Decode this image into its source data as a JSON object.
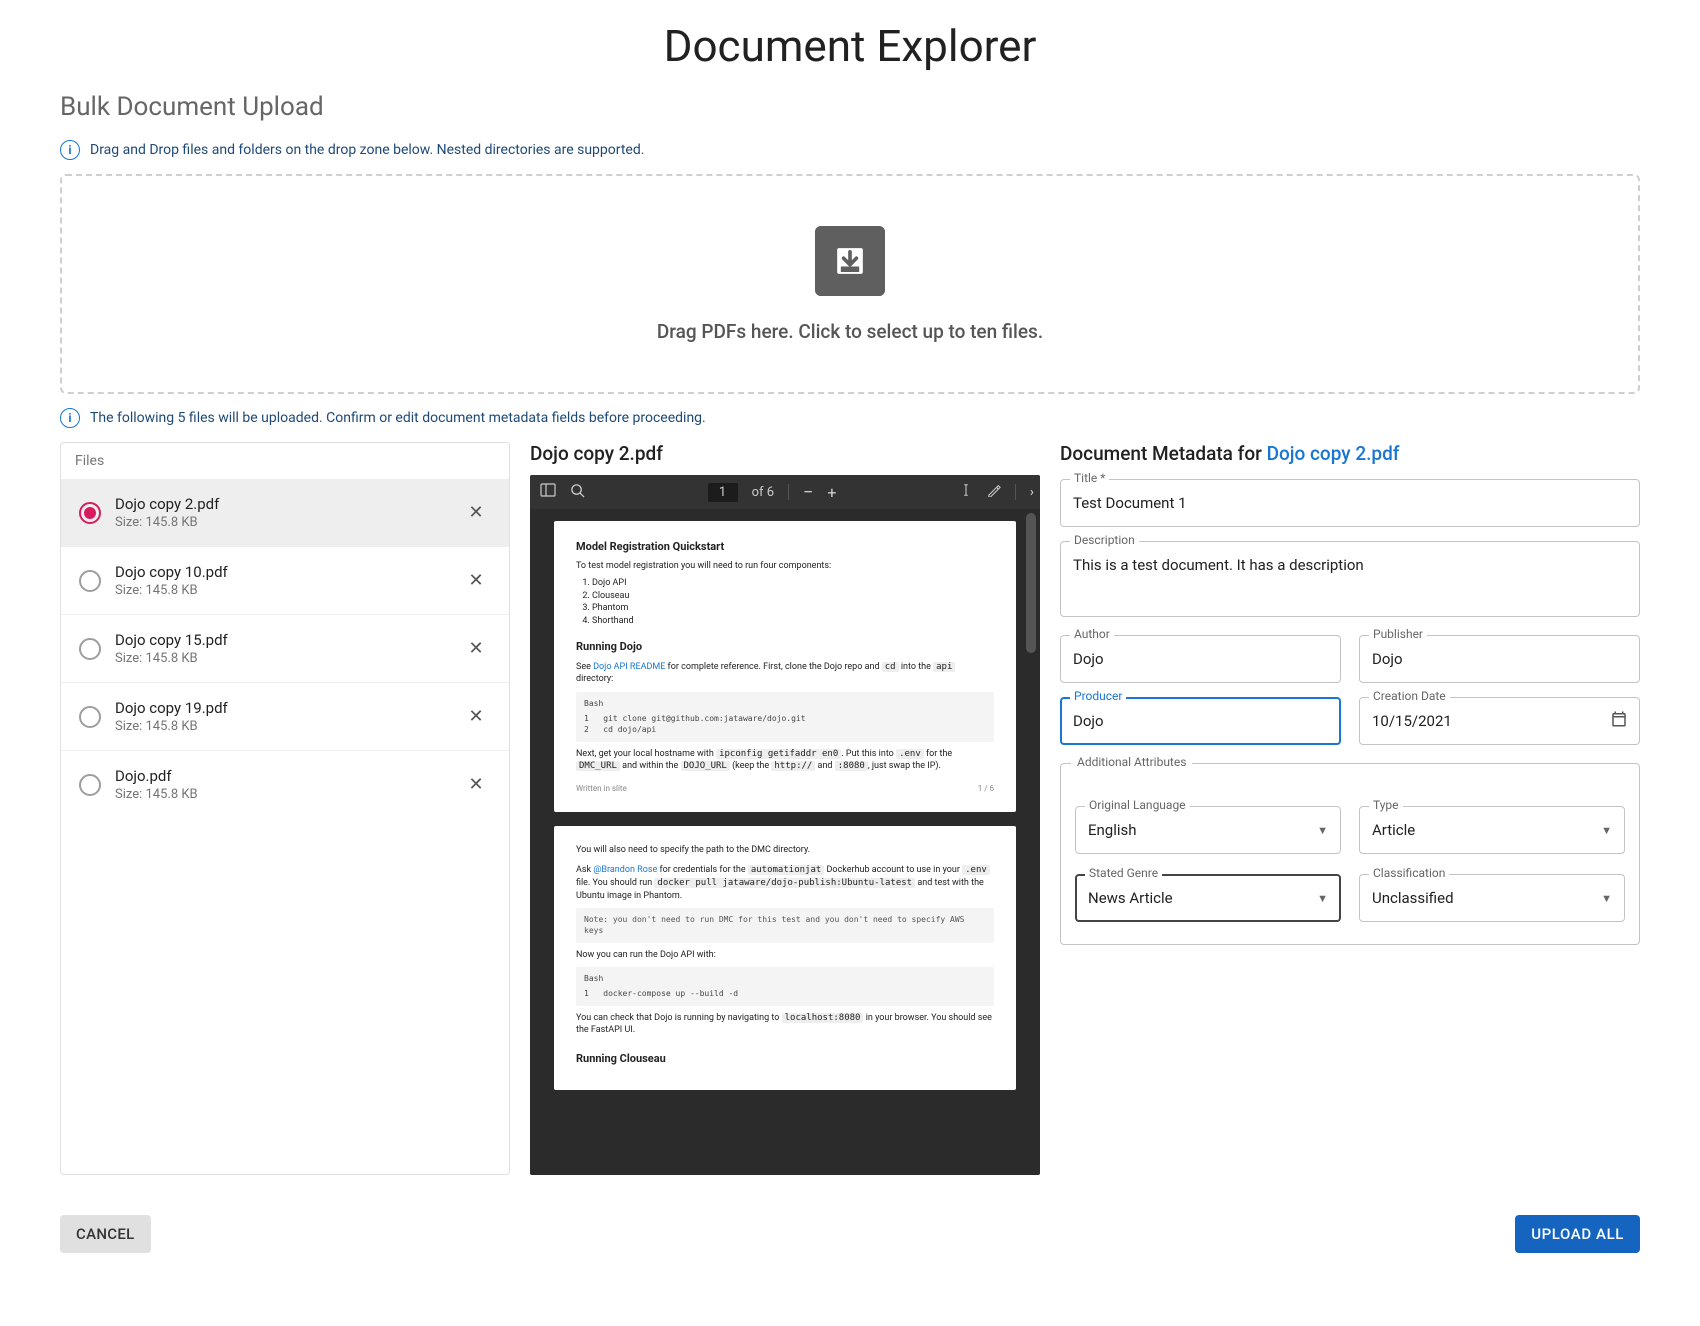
{
  "page": {
    "title": "Document Explorer",
    "section": "Bulk Document Upload"
  },
  "info": {
    "drag_drop": "Drag and Drop files and folders on the drop zone below. Nested directories are supported.",
    "upload_summary": "The following 5 files will be uploaded. Confirm or edit document metadata fields before proceeding."
  },
  "dropzone": {
    "text": "Drag PDFs here. Click to select up to ten files."
  },
  "files": {
    "header": "Files",
    "items": [
      {
        "name": "Dojo copy 2.pdf",
        "size": "Size: 145.8 KB",
        "selected": true
      },
      {
        "name": "Dojo copy 10.pdf",
        "size": "Size: 145.8 KB",
        "selected": false
      },
      {
        "name": "Dojo copy 15.pdf",
        "size": "Size: 145.8 KB",
        "selected": false
      },
      {
        "name": "Dojo copy 19.pdf",
        "size": "Size: 145.8 KB",
        "selected": false
      },
      {
        "name": "Dojo.pdf",
        "size": "Size: 145.8 KB",
        "selected": false
      }
    ]
  },
  "preview": {
    "title": "Dojo copy 2.pdf",
    "page_current": "1",
    "page_total": "of 6",
    "page": {
      "heading": "Model Registration Quickstart",
      "intro": "To test model registration you will need to run four components:",
      "components": [
        "Dojo API",
        "Clouseau",
        "Phantom",
        "Shorthand"
      ],
      "running_heading": "Running Dojo",
      "running_text_1": "See ",
      "running_link": "Dojo API README",
      "running_text_2": " for complete reference. First, clone the Dojo repo and ",
      "running_code_1": "cd",
      "running_text_3": " into the ",
      "running_code_2": "api",
      "running_text_4": " directory:",
      "bash_label": "Bash",
      "bash_block_1a": "git clone git@github.com:jataware/dojo.git",
      "bash_block_1b": "cd dojo/api",
      "para2_a": "Next, get your local hostname with ",
      "para2_code1": "ipconfig getifaddr en0",
      "para2_b": ". Put this into ",
      "para2_code2": ".env",
      "para2_c": " for the ",
      "para2_code3": "DMC_URL",
      "para2_d": " and within the ",
      "para2_code4": "DOJO_URL",
      "para2_e": " (keep the ",
      "para2_code5": "http://",
      "para2_f": " and ",
      "para2_code6": ":8080",
      "para2_g": ", just swap the IP).",
      "footer_left": "Written in slite",
      "footer_right": "1 / 6",
      "page2_line1": "You will also need to specify the path to the DMC directory.",
      "page2_a": "Ask ",
      "page2_link": "@Brandon Rose",
      "page2_b": " for credentials for the ",
      "page2_code1": "automationjat",
      "page2_c": " Dockerhub account to use in your ",
      "page2_code2": ".env",
      "page2_d": " file. You should run ",
      "page2_code3": "docker pull jataware/dojo-publish:Ubuntu-latest",
      "page2_e": " and test with the Ubuntu image in Phantom.",
      "note": "Note: you don't need to run DMC for this test and you don't need to specify AWS keys",
      "page2_line3": "Now you can run the Dojo API with:",
      "bash_block_2": "docker-compose up --build -d",
      "page2_line4a": "You can check that Dojo is running by navigating to ",
      "page2_code4": "localhost:8080",
      "page2_line4b": " in your browser. You should see the FastAPI UI.",
      "running_clouseau": "Running Clouseau"
    }
  },
  "metadata": {
    "header_prefix": "Document Metadata for ",
    "header_filename": "Dojo copy 2.pdf",
    "labels": {
      "title": "Title *",
      "description": "Description",
      "author": "Author",
      "publisher": "Publisher",
      "producer": "Producer",
      "creation_date": "Creation Date",
      "additional": "Additional Attributes",
      "original_language": "Original Language",
      "type": "Type",
      "stated_genre": "Stated Genre",
      "classification": "Classification"
    },
    "values": {
      "title": "Test Document 1",
      "description": "This is a test document. It has a description",
      "author": "Dojo",
      "publisher": "Dojo",
      "producer": "Dojo",
      "creation_date": "10/15/2021",
      "original_language": "English",
      "type": "Article",
      "stated_genre": "News Article",
      "classification": "Unclassified"
    }
  },
  "actions": {
    "cancel": "CANCEL",
    "upload": "UPLOAD ALL"
  }
}
